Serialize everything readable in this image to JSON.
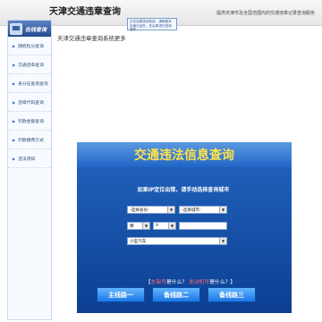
{
  "header": {
    "site_title": "天津交通违章查询",
    "notice": "正在加载查询系统，请稍候本页面已经在，先后再进行查询操作",
    "service_desc": "提供天津市及全国范围内的交通违章记录查询服务"
  },
  "sidebar": {
    "heading": "在线查询",
    "items": [
      {
        "label": "随机粒分查询"
      },
      {
        "label": "交通违章查询"
      },
      {
        "label": "身分证查询查询"
      },
      {
        "label": "违章代码查询"
      },
      {
        "label": "罚款金额查询"
      },
      {
        "label": "罚款缴费方式"
      },
      {
        "label": "违法须知"
      }
    ]
  },
  "main": {
    "title": "天津交通违章查询系统更多",
    "banner": "交通违法信息查询",
    "prompt": "如果IP定位出错，请手动选择查询城市",
    "province_select": "-选择省份-",
    "city_select": "-选择城市-",
    "plate_prefix_select": "豫",
    "plate_letter_select": "A",
    "vehicle_type_select": "小型汽车",
    "help": {
      "open": "【",
      "link1": "车架号",
      "mid1": "是什么？",
      "link2": "发动机号",
      "mid2": "是什么？",
      "close": "】"
    },
    "routes": [
      "主线路一",
      "备线路二",
      "备线路三"
    ]
  }
}
